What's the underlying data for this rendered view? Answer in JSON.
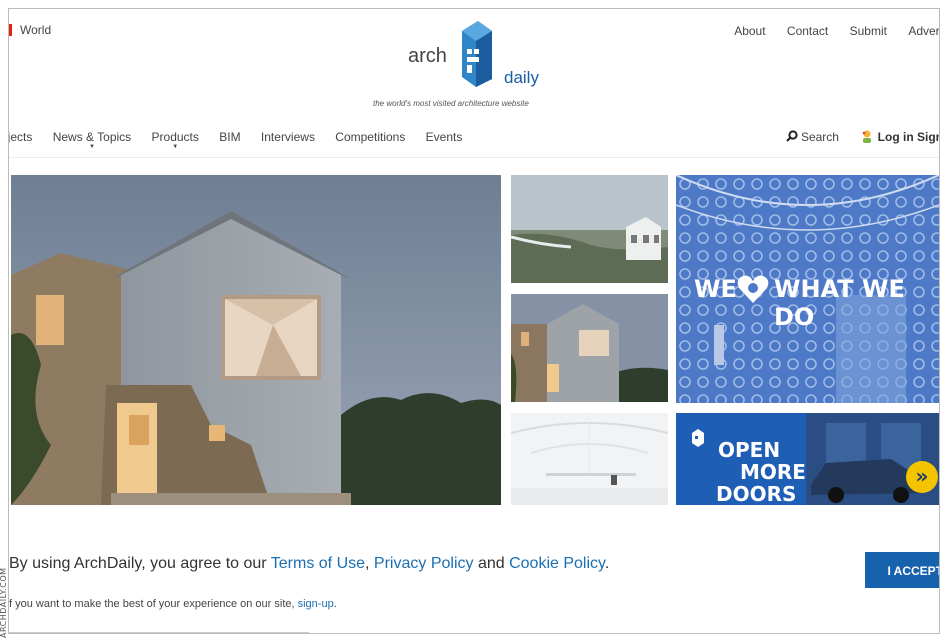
{
  "header": {
    "region_label": "World",
    "top_links": [
      "About",
      "Contact",
      "Submit",
      "Advert"
    ],
    "logo_left": "arch",
    "logo_right": "daily",
    "tagline": "the world's most visited architecture website"
  },
  "nav": {
    "items": [
      {
        "label": "ojects",
        "caret": false
      },
      {
        "label": "News & Topics",
        "caret": true
      },
      {
        "label": "Products",
        "caret": true
      },
      {
        "label": "BIM",
        "caret": false
      },
      {
        "label": "Interviews",
        "caret": false
      },
      {
        "label": "Competitions",
        "caret": false
      },
      {
        "label": "Events",
        "caret": false
      }
    ],
    "search_label": "Search",
    "login_label": "Log in",
    "signup_label": "Sign"
  },
  "ads": {
    "ad1_left": "WE",
    "ad1_right": "WHAT WE DO",
    "ad2_lines": [
      "OPEN",
      "MORE",
      "DOORS"
    ],
    "ad2_arrow": "»"
  },
  "cookie": {
    "prefix": "By using ArchDaily, you agree to our ",
    "terms": "Terms of Use",
    "comma": ", ",
    "privacy": "Privacy Policy",
    "and": " and ",
    "cookie_policy": "Cookie Policy",
    "suffix": ".",
    "sub_prefix": "f you want to make the best of your experience on our site, ",
    "sub_link": "sign-up",
    "sub_suffix": ".",
    "accept_label": "I ACCEPT"
  },
  "credit": "ARCHDAILY.COM",
  "colors": {
    "brand_blue": "#1b5fa8",
    "accept_blue": "#1762ad",
    "link_blue": "#1b6fb0"
  }
}
